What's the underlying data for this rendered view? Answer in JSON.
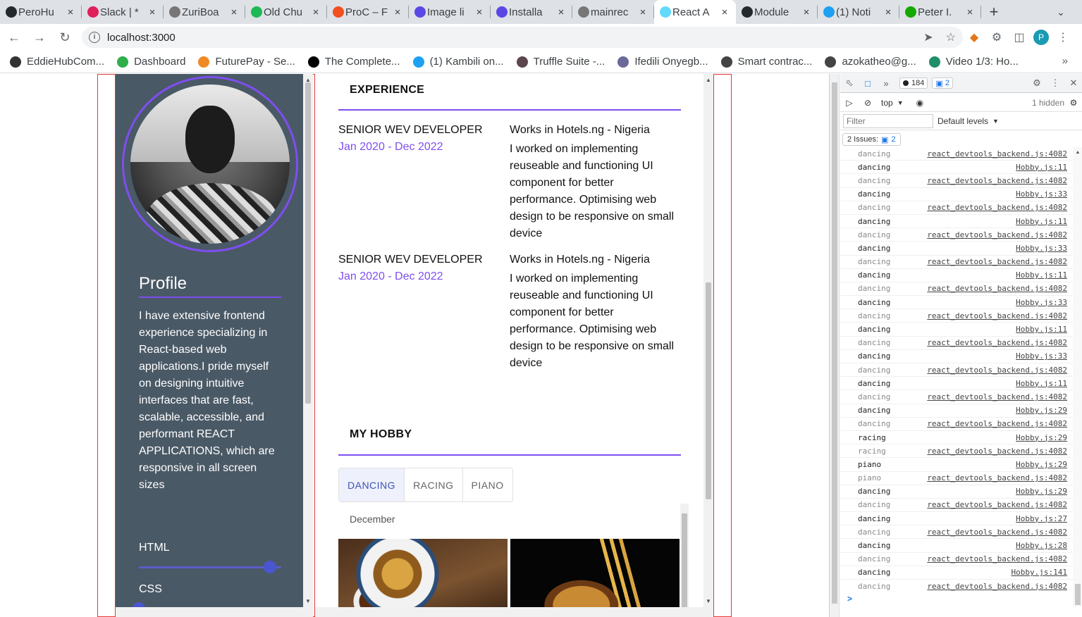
{
  "browser": {
    "tabs": [
      {
        "label": "PeroHu",
        "icon": "github-icon",
        "color": "#24292e"
      },
      {
        "label": "Slack | *",
        "icon": "slack-icon",
        "color": "#e01e5a"
      },
      {
        "label": "ZuriBoa",
        "icon": "globe-icon",
        "color": "#777777"
      },
      {
        "label": "Old Chu",
        "icon": "spotify-icon",
        "color": "#1db954"
      },
      {
        "label": "ProC – F",
        "icon": "figma-icon",
        "color": "#f24e1e"
      },
      {
        "label": "Image li",
        "icon": "docs-icon",
        "color": "#5a48e6"
      },
      {
        "label": "Installa",
        "icon": "docs-icon",
        "color": "#5a48e6"
      },
      {
        "label": "mainrec",
        "icon": "globe-icon",
        "color": "#777777"
      },
      {
        "label": "React A",
        "icon": "react-icon",
        "color": "#61dafb"
      },
      {
        "label": "Module",
        "icon": "github-icon",
        "color": "#24292e"
      },
      {
        "label": "(1) Noti",
        "icon": "twitter-icon",
        "color": "#1da1f2"
      },
      {
        "label": "Peter I.",
        "icon": "upwork-icon",
        "color": "#14a800"
      }
    ],
    "close_glyph": "×",
    "new_tab_glyph": "+",
    "url": "localhost:3000",
    "profile_initial": "P",
    "bookmarks": [
      {
        "label": "EddieHubCom...",
        "color": "#333333"
      },
      {
        "label": "Dashboard",
        "color": "#2eaf4a"
      },
      {
        "label": "FuturePay - Se...",
        "color": "#f08a24"
      },
      {
        "label": "The Complete...",
        "color": "#000000"
      },
      {
        "label": "(1) Kambili on...",
        "color": "#1da1f2"
      },
      {
        "label": "Truffle Suite -...",
        "color": "#5e464d"
      },
      {
        "label": "Ifedili Onyegb...",
        "color": "#6a6a9a"
      },
      {
        "label": "Smart contrac...",
        "color": "#444444"
      },
      {
        "label": "azokatheo@g...",
        "color": "#444444"
      },
      {
        "label": "Video 1/3: Ho...",
        "color": "#1f8f6a"
      }
    ],
    "bookmark_more": "»"
  },
  "profile": {
    "heading": "Profile",
    "bio": "I have extensive frontend experience specializing in React-based web applications.I pride myself on designing intuitive interfaces that are fast, scalable, accessible, and performant REACT APPLICATIONS, which are responsive in all screen sizes",
    "skills": [
      {
        "name": "HTML",
        "level": 0.92
      },
      {
        "name": "CSS",
        "level": 0.0
      }
    ]
  },
  "experience": {
    "heading": "EXPERIENCE",
    "jobs": [
      {
        "role": "SENIOR WEV DEVELOPER",
        "dates": "Jan 2020 - Dec 2022",
        "company": "Works in Hotels.ng - Nigeria",
        "description": "I worked on implementing reuseable and functioning UI component for better performance. Optimising web design to be responsive on small device"
      },
      {
        "role": "SENIOR WEV DEVELOPER",
        "dates": "Jan 2020 - Dec 2022",
        "company": "Works in Hotels.ng - Nigeria",
        "description": "I worked on implementing reuseable and functioning UI component for better performance. Optimising web design to be responsive on small device"
      }
    ]
  },
  "hobby": {
    "heading": "MY HOBBY",
    "tabs": [
      "DANCING",
      "RACING",
      "PIANO"
    ],
    "active_tab": "DANCING",
    "month": "December"
  },
  "devtools": {
    "error_count": "184",
    "message_count": "2",
    "context": "top",
    "hidden": "1 hidden",
    "filter_placeholder": "Filter",
    "levels": "Default levels",
    "issues_label": "2 Issues:",
    "issues_count": "2",
    "logs": [
      {
        "msg": "dancing",
        "src": "react_devtools_backend.js:4082",
        "faint": true
      },
      {
        "msg": "dancing",
        "src": "Hobby.js:11",
        "faint": false
      },
      {
        "msg": "dancing",
        "src": "react_devtools_backend.js:4082",
        "faint": true
      },
      {
        "msg": "dancing",
        "src": "Hobby.js:33",
        "faint": false
      },
      {
        "msg": "dancing",
        "src": "react_devtools_backend.js:4082",
        "faint": true
      },
      {
        "msg": "dancing",
        "src": "Hobby.js:11",
        "faint": false
      },
      {
        "msg": "dancing",
        "src": "react_devtools_backend.js:4082",
        "faint": true
      },
      {
        "msg": "dancing",
        "src": "Hobby.js:33",
        "faint": false
      },
      {
        "msg": "dancing",
        "src": "react_devtools_backend.js:4082",
        "faint": true
      },
      {
        "msg": "dancing",
        "src": "Hobby.js:11",
        "faint": false
      },
      {
        "msg": "dancing",
        "src": "react_devtools_backend.js:4082",
        "faint": true
      },
      {
        "msg": "dancing",
        "src": "Hobby.js:33",
        "faint": false
      },
      {
        "msg": "dancing",
        "src": "react_devtools_backend.js:4082",
        "faint": true
      },
      {
        "msg": "dancing",
        "src": "Hobby.js:11",
        "faint": false
      },
      {
        "msg": "dancing",
        "src": "react_devtools_backend.js:4082",
        "faint": true
      },
      {
        "msg": "dancing",
        "src": "Hobby.js:33",
        "faint": false
      },
      {
        "msg": "dancing",
        "src": "react_devtools_backend.js:4082",
        "faint": true
      },
      {
        "msg": "dancing",
        "src": "Hobby.js:11",
        "faint": false
      },
      {
        "msg": "dancing",
        "src": "react_devtools_backend.js:4082",
        "faint": true
      },
      {
        "msg": "dancing",
        "src": "Hobby.js:29",
        "faint": false
      },
      {
        "msg": "dancing",
        "src": "react_devtools_backend.js:4082",
        "faint": true
      },
      {
        "msg": "racing",
        "src": "Hobby.js:29",
        "faint": false
      },
      {
        "msg": "racing",
        "src": "react_devtools_backend.js:4082",
        "faint": true
      },
      {
        "msg": "piano",
        "src": "Hobby.js:29",
        "faint": false
      },
      {
        "msg": "piano",
        "src": "react_devtools_backend.js:4082",
        "faint": true
      },
      {
        "msg": "dancing",
        "src": "Hobby.js:29",
        "faint": false
      },
      {
        "msg": "dancing",
        "src": "react_devtools_backend.js:4082",
        "faint": true
      },
      {
        "msg": "dancing",
        "src": "Hobby.js:27",
        "faint": false
      },
      {
        "msg": "dancing",
        "src": "react_devtools_backend.js:4082",
        "faint": true
      },
      {
        "msg": "dancing",
        "src": "Hobby.js:28",
        "faint": false
      },
      {
        "msg": "dancing",
        "src": "react_devtools_backend.js:4082",
        "faint": true
      },
      {
        "msg": "dancing",
        "src": "Hobby.js:141",
        "faint": false
      },
      {
        "msg": "dancing",
        "src": "react_devtools_backend.js:4082",
        "faint": true
      }
    ],
    "prompt_glyph": ">"
  },
  "colors": {
    "accent": "#7e4ef0",
    "sidebar_bg": "#4a5966",
    "outline": "#e53935",
    "tab_active": "#3f51b5"
  }
}
